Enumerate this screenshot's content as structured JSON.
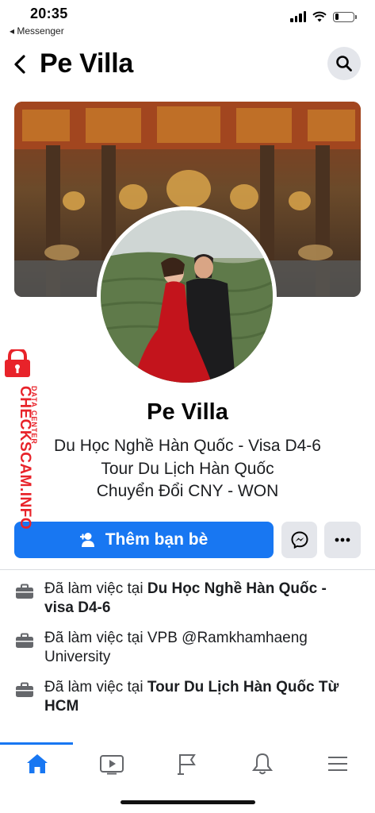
{
  "status_bar": {
    "time": "20:35",
    "back_app": "◂ Messenger",
    "battery_level": 0.2
  },
  "header": {
    "title": "Pe Villa",
    "back_icon": "chevron-left-icon",
    "search_icon": "search-icon"
  },
  "profile": {
    "name": "Pe Villa",
    "bio": [
      "Du Học Nghề Hàn Quốc - Visa D4-6",
      "Tour Du Lịch Hàn Quốc",
      "Chuyển Đổi CNY - WON"
    ]
  },
  "actions": {
    "add_friend_label": "Thêm bạn bè",
    "messenger_icon": "messenger-icon",
    "more_icon": "more-horizontal-icon"
  },
  "info": {
    "items": [
      {
        "prefix": "Đã làm việc tại ",
        "bold": "Du Học Nghề Hàn Quốc - visa D4-6",
        "icon": "briefcase-icon"
      },
      {
        "prefix": "Đã làm việc tại VPB @Ramkhamhaeng University",
        "bold": "",
        "icon": "briefcase-icon"
      },
      {
        "prefix": "Đã làm việc tại ",
        "bold": "Tour Du Lịch Hàn Quốc Từ HCM",
        "icon": "briefcase-icon"
      }
    ]
  },
  "bottom_nav": {
    "items": [
      "home-icon",
      "video-icon",
      "pages-flag-icon",
      "notifications-bell-icon",
      "menu-icon"
    ],
    "active": "home-icon"
  },
  "watermark": {
    "line1": "DATA CENTER",
    "line2": "CHECKSCAM.INFO"
  },
  "colors": {
    "accent": "#1877f2",
    "button_gray": "#e4e6eb",
    "watermark_red": "#e8232a"
  }
}
